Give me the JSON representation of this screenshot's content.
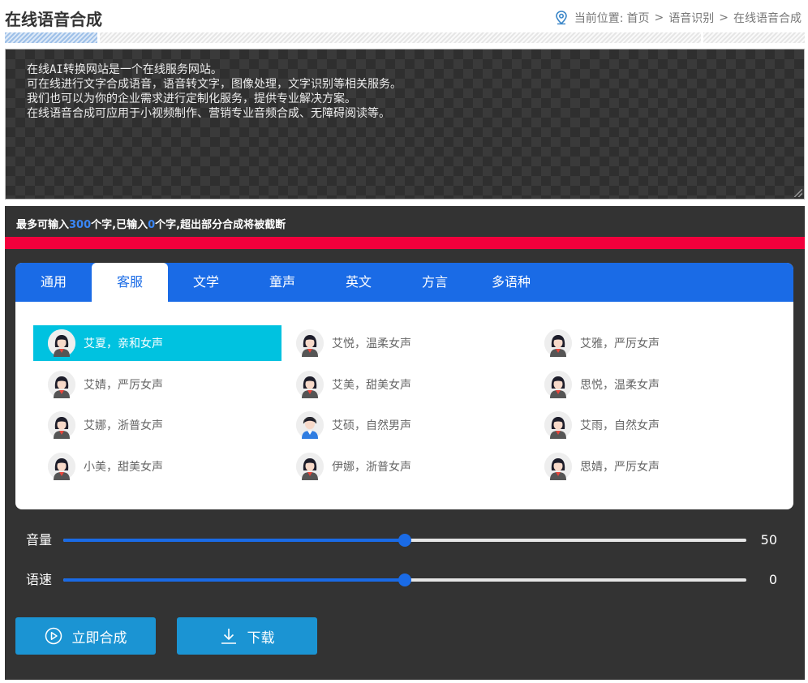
{
  "header": {
    "title": "在线语音合成",
    "breadcrumb": {
      "prefix": "当前位置:",
      "items": [
        "首页",
        "语音识别",
        "在线语音合成"
      ],
      "separator": ">"
    }
  },
  "editor": {
    "text": "在线AI转换网站是一个在线服务网站。\n可在线进行文字合成语音，语音转文字，图像处理，文字识别等相关服务。\n我们也可以为你的企业需求进行定制化服务，提供专业解决方案。\n在线语音合成可应用于小视频制作、营销专业音频合成、无障碍阅读等。"
  },
  "char_info": {
    "part1": "最多可输入",
    "max": "300",
    "part2": "个字,已输入",
    "count": "0",
    "part3": "个字,超出部分合成将被截断"
  },
  "tabs": [
    {
      "label": "通用"
    },
    {
      "label": "客服"
    },
    {
      "label": "文学"
    },
    {
      "label": "童声"
    },
    {
      "label": "英文"
    },
    {
      "label": "方言"
    },
    {
      "label": "多语种"
    }
  ],
  "active_tab": "客服",
  "voices": [
    {
      "label": "艾夏，亲和女声",
      "gender": "female"
    },
    {
      "label": "艾悦，温柔女声",
      "gender": "female"
    },
    {
      "label": "艾雅，严厉女声",
      "gender": "female"
    },
    {
      "label": "艾婧，严厉女声",
      "gender": "female"
    },
    {
      "label": "艾美，甜美女声",
      "gender": "female"
    },
    {
      "label": "思悦，温柔女声",
      "gender": "female"
    },
    {
      "label": "艾娜，浙普女声",
      "gender": "female"
    },
    {
      "label": "艾硕，自然男声",
      "gender": "male"
    },
    {
      "label": "艾雨，自然女声",
      "gender": "female"
    },
    {
      "label": "小美，甜美女声",
      "gender": "female"
    },
    {
      "label": "伊娜，浙普女声",
      "gender": "female"
    },
    {
      "label": "思婧，严厉女声",
      "gender": "female"
    }
  ],
  "selected_voice": "艾夏，亲和女声",
  "sliders": {
    "volume": {
      "label": "音量",
      "value": "50",
      "fraction": 0.5
    },
    "speed": {
      "label": "语速",
      "value": "0",
      "fraction": 0.5
    }
  },
  "buttons": {
    "synthesize": {
      "label": "立即合成",
      "icon": "play-circle-icon"
    },
    "download": {
      "label": "下载",
      "icon": "download-icon"
    }
  },
  "colors": {
    "tab_bar": "#1a6be6",
    "selected_voice": "#00c2e0",
    "button": "#1b94d3",
    "alert_bar": "#f2003c",
    "highlight_number": "#3a86f5"
  }
}
